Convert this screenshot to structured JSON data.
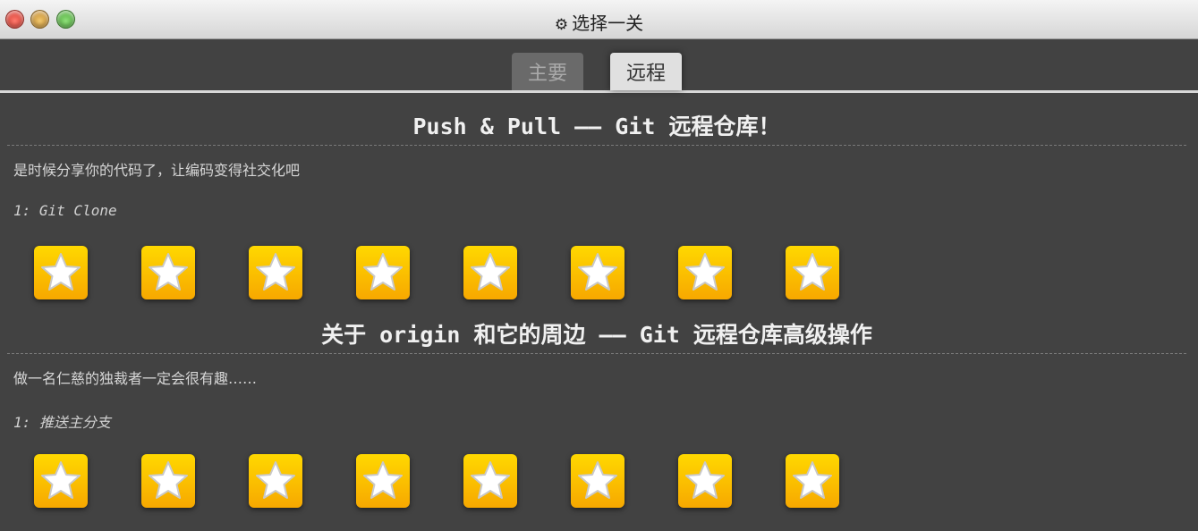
{
  "window": {
    "title": "选择一关",
    "title_icon": "gear-icon"
  },
  "tabs": [
    {
      "label": "主要",
      "active": false
    },
    {
      "label": "远程",
      "active": true
    }
  ],
  "colors": {
    "background": "#424242",
    "star_button": "#f9c000",
    "active_tab": "#e0e0e0",
    "inactive_tab": "#6a6a6a"
  },
  "sections": [
    {
      "title": "Push & Pull —— Git 远程仓库！",
      "description": "是时候分享你的代码了，让编码变得社交化吧",
      "group_label": "1: Git Clone",
      "levels": 8,
      "level_icon": "star-icon"
    },
    {
      "title": "关于 origin 和它的周边 —— Git 远程仓库高级操作",
      "description": "做一名仁慈的独裁者一定会很有趣……",
      "group_label": "1: 推送主分支",
      "levels": 8,
      "level_icon": "star-icon"
    }
  ]
}
